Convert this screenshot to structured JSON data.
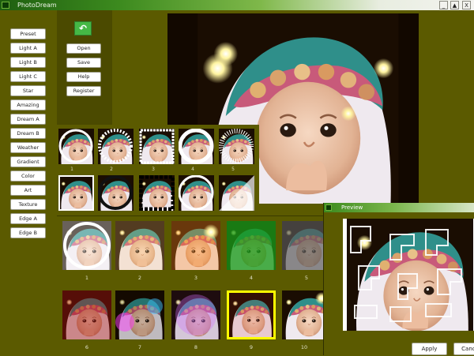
{
  "window": {
    "title": "PhotoDream",
    "controls": [
      "_",
      "▲",
      "X"
    ]
  },
  "effects": [
    "Preset",
    "Light A",
    "Light B",
    "Light C",
    "Star",
    "Amazing",
    "Dream A",
    "Dream B",
    "Weather",
    "Gradient",
    "Color",
    "Art",
    "Texture",
    "Edge A",
    "Edge B"
  ],
  "file_buttons": {
    "open": "Open",
    "save": "Save",
    "help": "Help",
    "register": "Register"
  },
  "undo_icon": "undo-arrow-icon",
  "thumbs_small": [
    "1",
    "2",
    "3",
    "4",
    "5"
  ],
  "thumbs_large": [
    "1",
    "2",
    "3",
    "4",
    "5",
    "6",
    "7",
    "8",
    "9",
    "10"
  ],
  "preview": {
    "title": "Preview",
    "apply": "Apply",
    "cancel": "Cancel"
  },
  "colors": {
    "panel": "#5b5a00",
    "titlebar": "#3c8a1e",
    "selected_frame": "#ffff00"
  }
}
